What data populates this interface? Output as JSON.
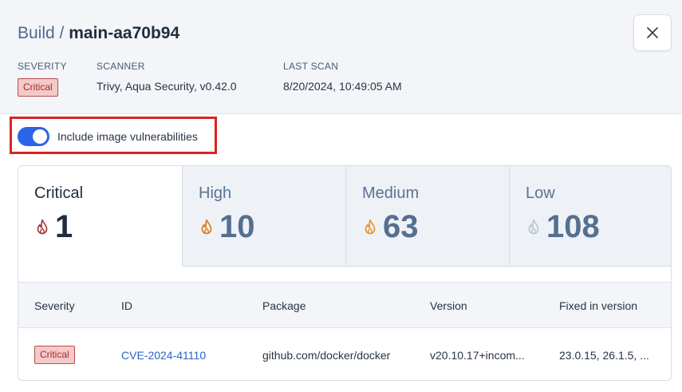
{
  "header": {
    "breadcrumb": "Build /",
    "build_name": "main-aa70b94",
    "close_icon": "close-icon",
    "severity_label": "SEVERITY",
    "severity_value": "Critical",
    "scanner_label": "SCANNER",
    "scanner_value": "Trivy, Aqua Security, v0.42.0",
    "last_scan_label": "LAST SCAN",
    "last_scan_value": "8/20/2024, 10:49:05 AM"
  },
  "toggle": {
    "label": "Include image vulnerabilities",
    "checked": true,
    "color": "#2a64e8"
  },
  "severity_tabs": [
    {
      "label": "Critical",
      "count": "1",
      "icon": "flame-icon",
      "color": "#a33a3a",
      "active": true
    },
    {
      "label": "High",
      "count": "10",
      "icon": "flame-icon",
      "color": "#e07a1f",
      "active": false
    },
    {
      "label": "Medium",
      "count": "63",
      "icon": "flame-icon",
      "color": "#e8962a",
      "active": false
    },
    {
      "label": "Low",
      "count": "108",
      "icon": "flame-icon",
      "color": "#b9c6d8",
      "active": false
    }
  ],
  "table": {
    "headers": [
      "Severity",
      "ID",
      "Package",
      "Version",
      "Fixed in version"
    ],
    "rows": [
      {
        "severity": "Critical",
        "id": "CVE-2024-41110",
        "package": "github.com/docker/docker",
        "version": "v20.10.17+incom...",
        "fixed_in": "23.0.15, 26.1.5, ..."
      }
    ]
  }
}
